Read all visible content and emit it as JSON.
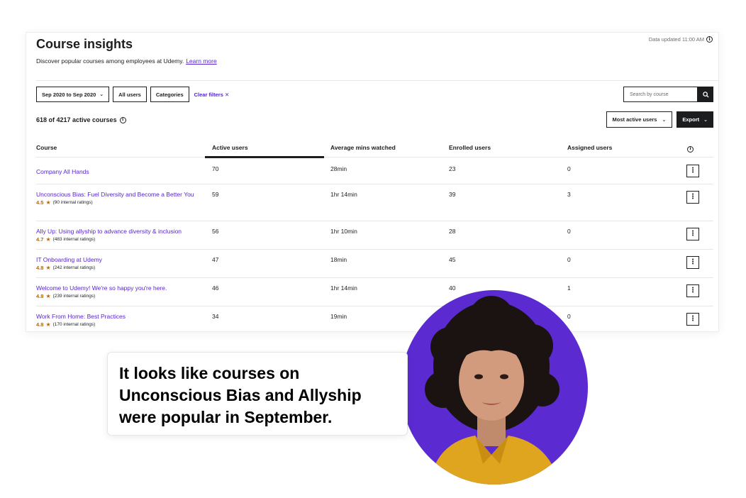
{
  "header": {
    "title": "Course insights",
    "subtitle": "Discover popular courses among employees at Udemy.",
    "learn_more": "Learn more",
    "data_updated": "Data updated 11:00 AM"
  },
  "filters": {
    "date_range": "Sep 2020 to Sep 2020",
    "users": "All users",
    "categories": "Categories",
    "clear": "Clear filters"
  },
  "search": {
    "placeholder": "Search by course"
  },
  "summary": {
    "count": "618 of 4217 active courses"
  },
  "actions": {
    "sort": "Most active users",
    "export": "Export"
  },
  "table": {
    "columns": [
      "Course",
      "Active users",
      "Average mins watched",
      "Enrolled users",
      "Assigned users"
    ],
    "rows": [
      {
        "course": "Company All Hands",
        "rating": "",
        "ratings_label": "",
        "active": "70",
        "avg": "28min",
        "enrolled": "23",
        "assigned": "0"
      },
      {
        "course": "Unconscious Bias: Fuel Diversity and Become a Better You",
        "rating": "4.5",
        "ratings_label": "(90 internal ratings)",
        "active": "59",
        "avg": "1hr 14min",
        "enrolled": "39",
        "assigned": "3"
      },
      {
        "course": "Ally Up: Using allyship to advance diversity & inclusion",
        "rating": "4.7",
        "ratings_label": "(483 internal ratings)",
        "active": "56",
        "avg": "1hr 10min",
        "enrolled": "28",
        "assigned": "0"
      },
      {
        "course": "IT Onboarding at Udemy",
        "rating": "4.8",
        "ratings_label": "(242 internal ratings)",
        "active": "47",
        "avg": "18min",
        "enrolled": "45",
        "assigned": "0"
      },
      {
        "course": "Welcome to Udemy! We're so happy you're here.",
        "rating": "4.8",
        "ratings_label": "(239 internal ratings)",
        "active": "46",
        "avg": "1hr 14min",
        "enrolled": "40",
        "assigned": "1"
      },
      {
        "course": "Work From Home: Best Practices",
        "rating": "4.8",
        "ratings_label": "(170 internal ratings)",
        "active": "34",
        "avg": "19min",
        "enrolled": "",
        "assigned": "0"
      }
    ]
  },
  "callout": {
    "text": "It looks like courses on Unconscious Bias and Allyship were popular in September."
  },
  "colors": {
    "accent": "#5624d0",
    "star": "#b4690e",
    "avatar_bg": "#5b2ad1",
    "dark": "#1c1d1f"
  },
  "icons": {
    "info": "info-icon",
    "search": "search-icon",
    "chevron": "chevron-down-icon",
    "kebab": "kebab-menu-icon",
    "star": "star-icon"
  }
}
